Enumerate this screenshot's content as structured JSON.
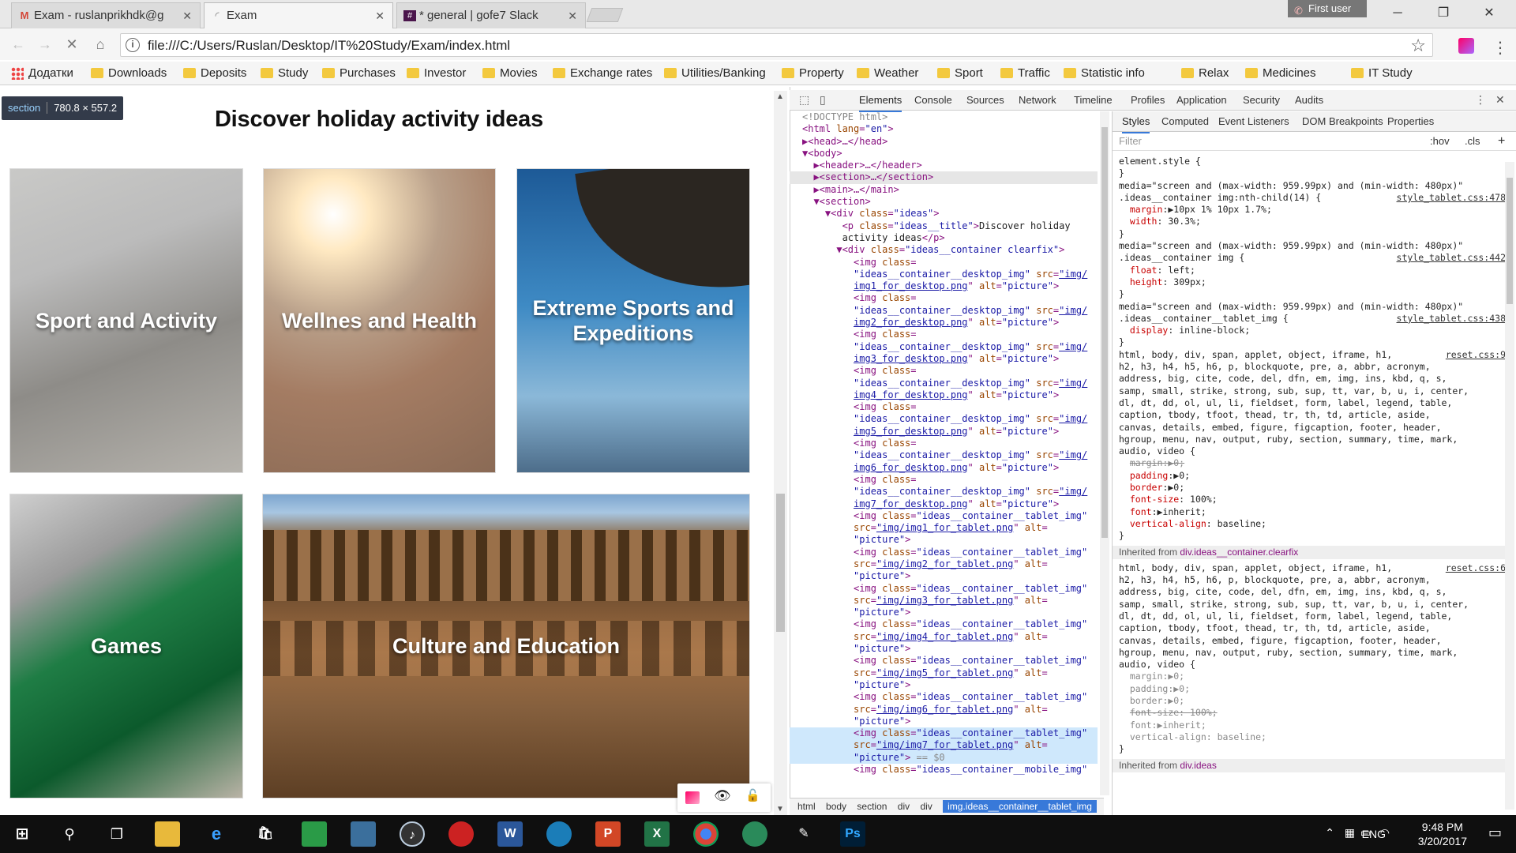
{
  "browser": {
    "tabs": [
      {
        "title": "Exam - ruslanprikhdk@g",
        "icon": "gmail-icon"
      },
      {
        "title": "Exam",
        "icon": "loading-icon"
      },
      {
        "title": "* general | gofe7 Slack",
        "icon": "slack-icon"
      }
    ],
    "user_label": "First user",
    "url": "file:///C:/Users/Ruslan/Desktop/IT%20Study/Exam/index.html",
    "bookmarks": [
      "Додатки",
      "Downloads",
      "Deposits",
      "Study",
      "Purchases",
      "Investor",
      "Movies",
      "Exchange rates",
      "Utilities/Banking",
      "Property",
      "Weather",
      "Sport",
      "Traffic",
      "Statistic info",
      "Relax",
      "Medicines",
      "IT Study"
    ]
  },
  "page": {
    "tooltip_tag": "section",
    "tooltip_size": "780.8 × 557.2",
    "headline": "Discover holiday activity ideas",
    "cards": [
      {
        "label": "Sport and Activity"
      },
      {
        "label": "Wellnes and Health"
      },
      {
        "label": "Extreme Sports and Expeditions"
      },
      {
        "label": "Games"
      },
      {
        "label": "Culture and Education"
      }
    ]
  },
  "devtools": {
    "tabs": [
      "Elements",
      "Console",
      "Sources",
      "Network",
      "Timeline",
      "Profiles",
      "Application",
      "Security",
      "Audits"
    ],
    "breadcrumb": [
      "html",
      "body",
      "section",
      "div",
      "div",
      "img.ideas__container__tablet_img"
    ],
    "styles_tabs": [
      "Styles",
      "Computed",
      "Event Listeners",
      "DOM Breakpoints",
      "Properties"
    ],
    "filter_placeholder": "Filter",
    "hov": ":hov",
    "cls": ".cls"
  },
  "taskbar": {
    "lang": "ENG",
    "time": "9:48 PM",
    "date": "3/20/2017"
  }
}
